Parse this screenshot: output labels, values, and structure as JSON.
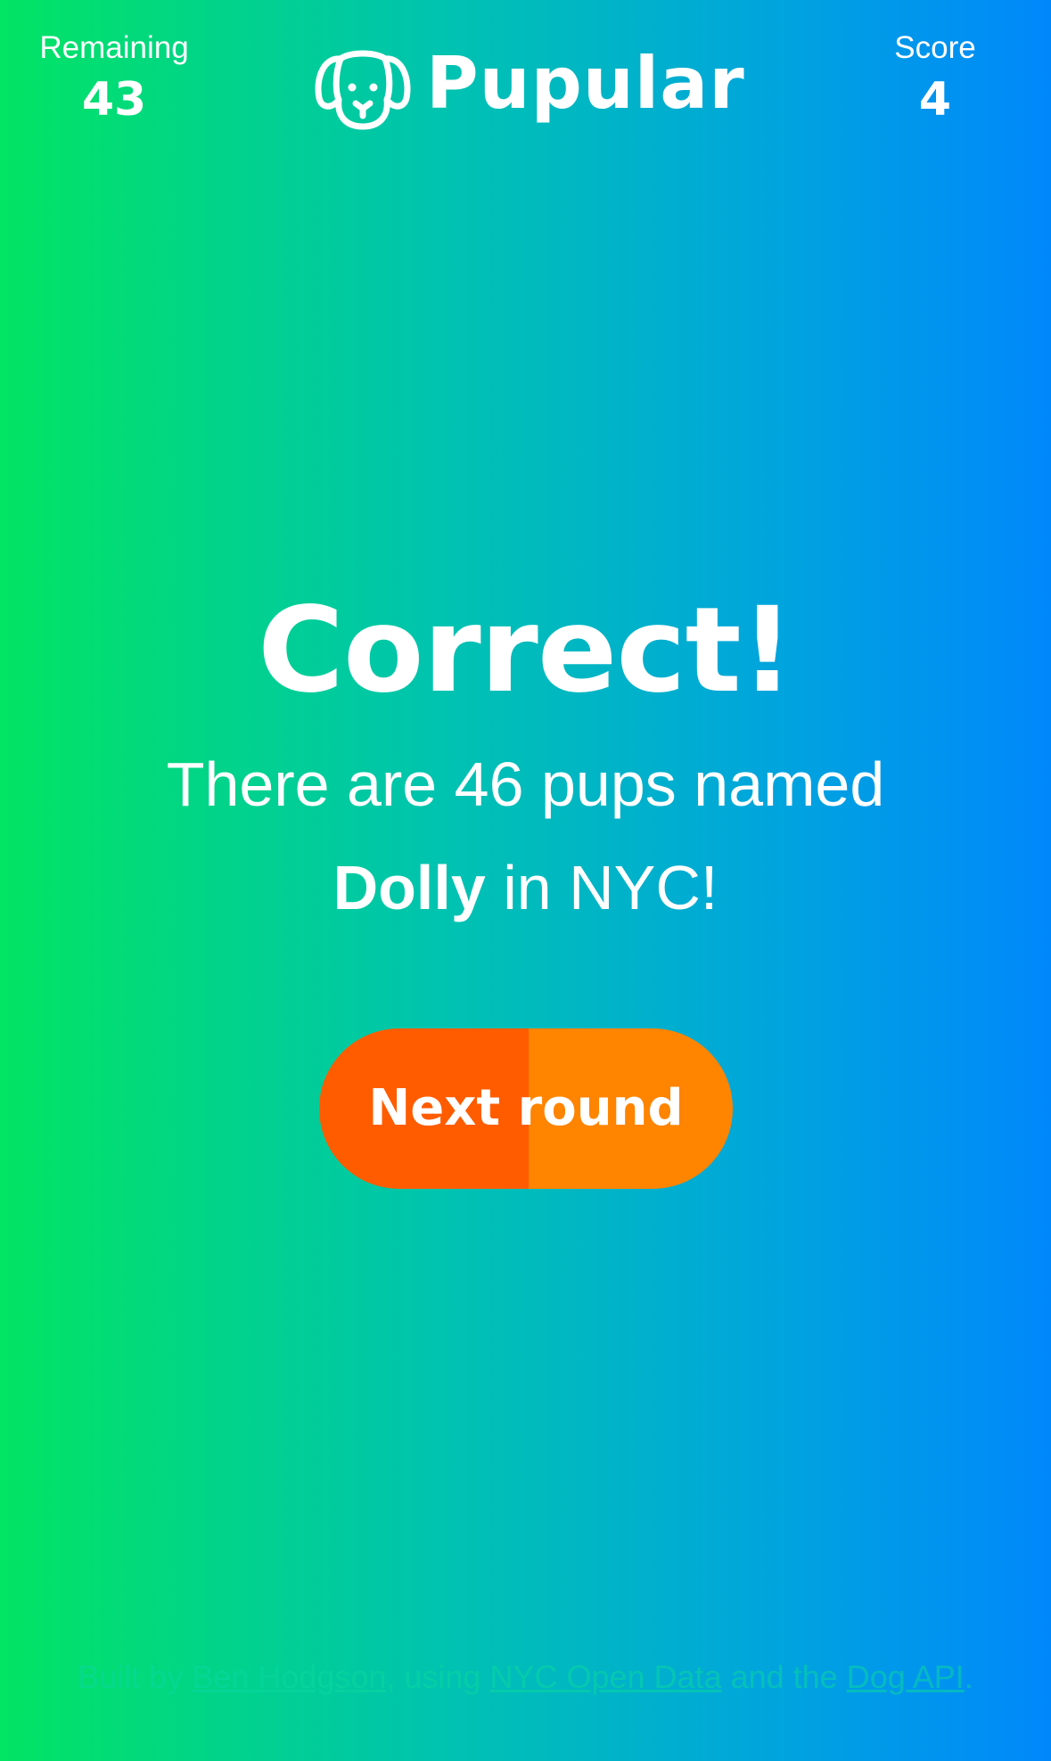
{
  "header": {
    "remaining_label": "Remaining",
    "remaining_value": "43",
    "score_label": "Score",
    "score_value": "4",
    "app_name": "Pupular",
    "logo_icon": "dog-face-icon"
  },
  "result": {
    "heading": "Correct!",
    "message_before": "There are 46 pups named",
    "pup_name": "Dolly",
    "message_after": " in NYC!"
  },
  "actions": {
    "next_label": "Next round"
  },
  "footer": {
    "built_by": "Built by ",
    "author_link": "Ben Hodgson",
    "using": ", using ",
    "data_link": "NYC Open Data",
    "and_the": " and the ",
    "api_link": "Dog API",
    "end": "."
  },
  "colors": {
    "gradient_start": "#02e463",
    "gradient_end": "#0088fb",
    "button_left": "#ff5c00",
    "button_right": "#ff8400",
    "text": "#ffffff"
  }
}
